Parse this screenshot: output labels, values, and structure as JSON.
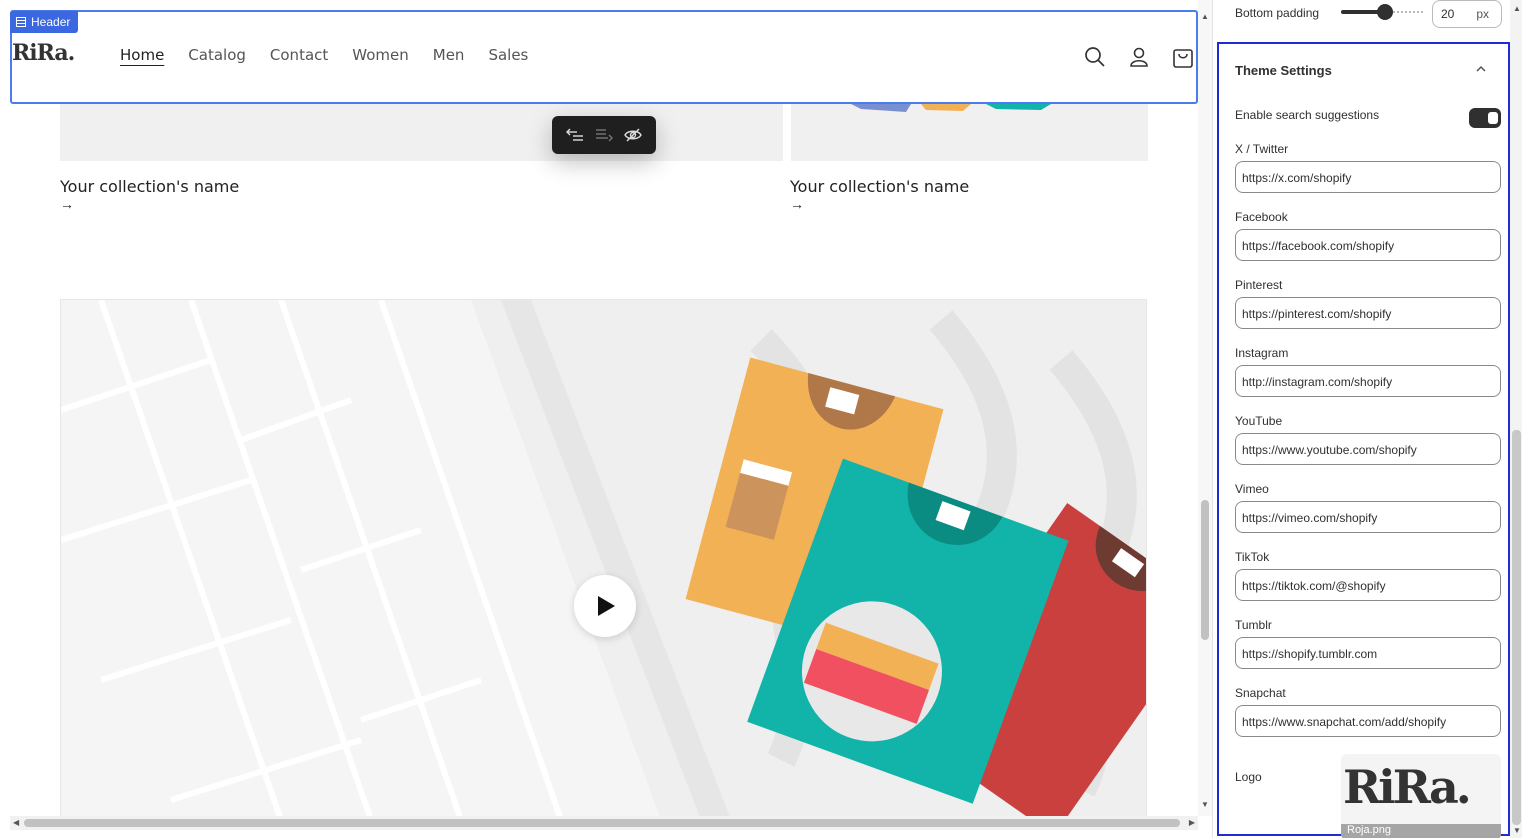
{
  "header": {
    "selection_tag": "Header",
    "logo": "RiRa.",
    "nav": [
      "Home",
      "Catalog",
      "Contact",
      "Women",
      "Men",
      "Sales"
    ],
    "active_nav": "Home"
  },
  "collections": [
    {
      "title": "Your collection's name",
      "arrow": "→"
    },
    {
      "title": "Your collection's name",
      "arrow": "→"
    }
  ],
  "video": {
    "play_icon": "play-icon"
  },
  "panel": {
    "bottom_padding": {
      "label": "Bottom padding",
      "value": "20",
      "unit": "px",
      "level": 0.5
    },
    "section_title": "Theme Settings",
    "search_suggestions": {
      "label": "Enable search suggestions",
      "enabled": true
    },
    "fields": [
      {
        "label": "X / Twitter",
        "value": "https://x.com/shopify"
      },
      {
        "label": "Facebook",
        "value": "https://facebook.com/shopify"
      },
      {
        "label": "Pinterest",
        "value": "https://pinterest.com/shopify"
      },
      {
        "label": "Instagram",
        "value": "http://instagram.com/shopify"
      },
      {
        "label": "YouTube",
        "value": "https://www.youtube.com/shopify"
      },
      {
        "label": "Vimeo",
        "value": "https://vimeo.com/shopify"
      },
      {
        "label": "TikTok",
        "value": "https://tiktok.com/@shopify"
      },
      {
        "label": "Tumblr",
        "value": "https://shopify.tumblr.com"
      },
      {
        "label": "Snapchat",
        "value": "https://www.snapchat.com/add/shopify"
      }
    ],
    "logo": {
      "label": "Logo",
      "image_text": "RiRa.",
      "filename": "Roja.png"
    }
  },
  "colors": {
    "selection": "#3b67e0",
    "panel_highlight": "#1f2bd4",
    "teal": "#12b3a8",
    "orange": "#f2b155",
    "red": "#c9403f"
  }
}
